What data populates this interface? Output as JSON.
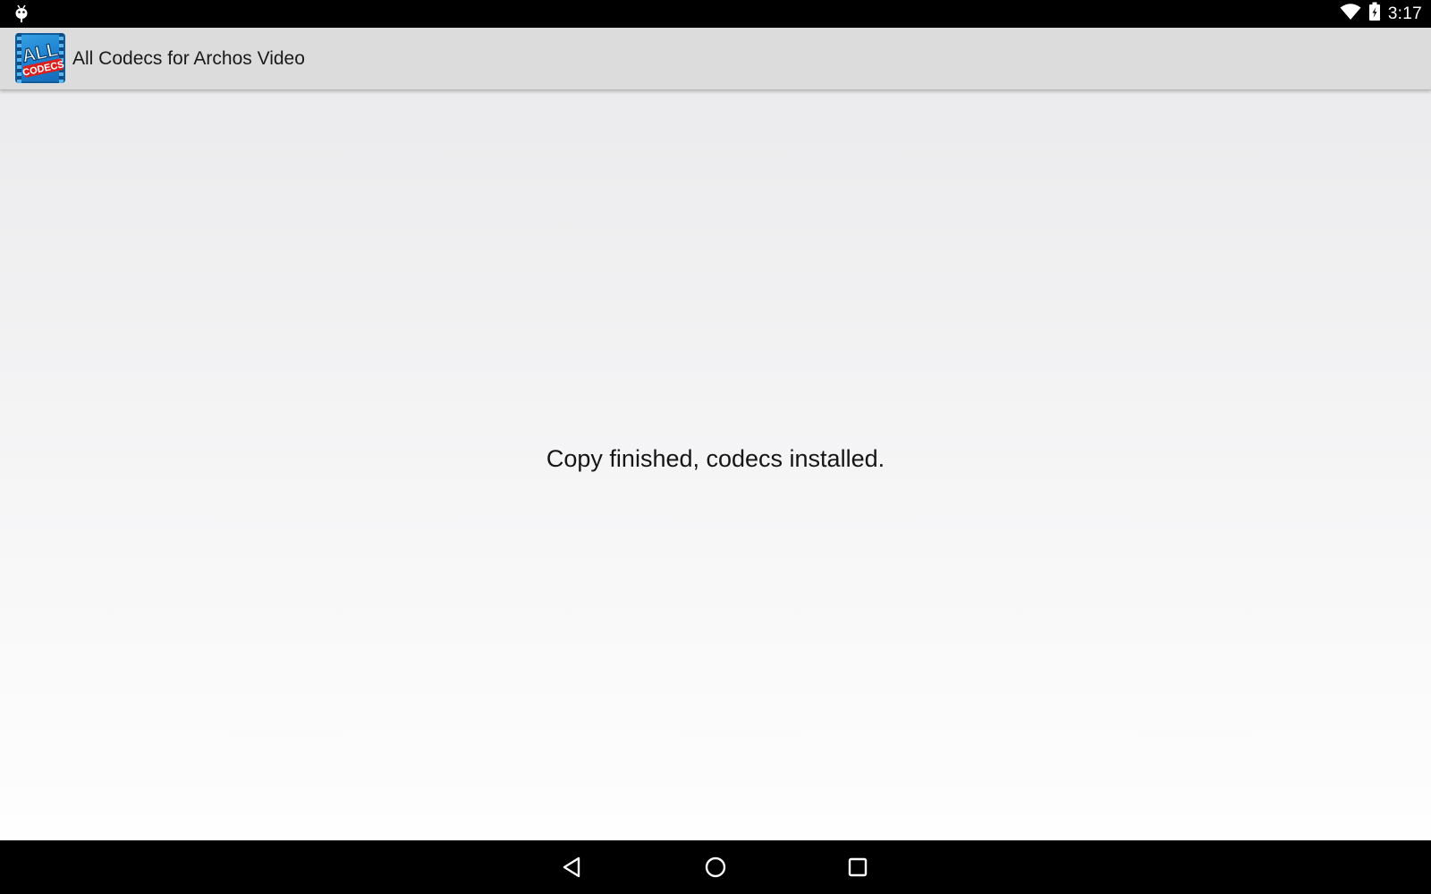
{
  "status_bar": {
    "time": "3:17",
    "icons": [
      "android-debug-icon",
      "wifi-icon",
      "battery-charging-icon"
    ]
  },
  "action_bar": {
    "app_icon": {
      "name": "all-codecs-app-icon",
      "line1": "ALL",
      "line2": "CODECS"
    },
    "title": "All Codecs for Archos Video"
  },
  "main": {
    "message": "Copy finished, codecs installed."
  },
  "navigation_bar": {
    "buttons": [
      "back-icon",
      "home-icon",
      "recents-icon"
    ]
  },
  "colors": {
    "status_bar": "#000000",
    "action_bar": "#dcdcdd",
    "content_top": "#ebebed",
    "content_bottom": "#fefefe",
    "icon_blue": "#1a7fd0",
    "icon_red": "#d9201f"
  }
}
